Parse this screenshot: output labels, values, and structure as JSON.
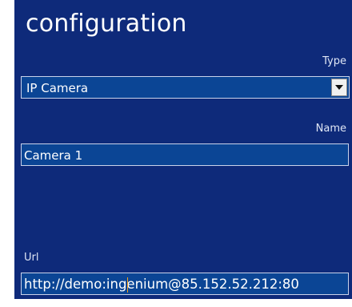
{
  "panel": {
    "title": "configuration"
  },
  "type_field": {
    "label": "Type",
    "selected": "IP Camera"
  },
  "name_field": {
    "label": "Name",
    "value": "Camera 1"
  },
  "url_field": {
    "label": "Url",
    "value": "http://demo:ingenium@85.152.52.212:80"
  },
  "colors": {
    "panel_bg": "#0e2a7a",
    "field_bg": "#0b4595",
    "field_border": "#c9d2ea",
    "text": "#ffffff",
    "caret": "#f0a020"
  }
}
